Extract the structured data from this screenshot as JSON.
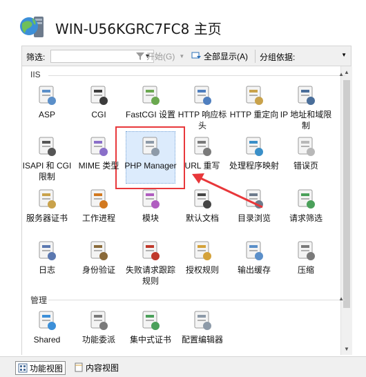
{
  "header": {
    "title": "WIN-U56KGRC7FC8 主页"
  },
  "toolbar": {
    "filter_label": "筛选:",
    "filter_value": "",
    "start_label": "开始(G)",
    "showall_label": "全部显示(A)",
    "groupby_label": "分组依据:"
  },
  "groups": [
    {
      "name": "IIS"
    },
    {
      "name": "管理"
    }
  ],
  "tiles": [
    {
      "label": "ASP",
      "icon": "asp-icon"
    },
    {
      "label": "CGI",
      "icon": "cgi-icon"
    },
    {
      "label": "FastCGI 设置",
      "icon": "fastcgi-icon"
    },
    {
      "label": "HTTP 响应标头",
      "icon": "http-headers-icon"
    },
    {
      "label": "HTTP 重定向",
      "icon": "http-redirect-icon"
    },
    {
      "label": "IP 地址和域限制",
      "icon": "ip-restrict-icon"
    },
    {
      "label": "ISAPI 和 CGI 限制",
      "icon": "isapi-cgi-icon"
    },
    {
      "label": "MIME 类型",
      "icon": "mime-icon"
    },
    {
      "label": "PHP Manager",
      "icon": "php-manager-icon"
    },
    {
      "label": "URL 重写",
      "icon": "url-rewrite-icon"
    },
    {
      "label": "处理程序映射",
      "icon": "handler-icon"
    },
    {
      "label": "错误页",
      "icon": "error-page-icon"
    },
    {
      "label": "服务器证书",
      "icon": "server-cert-icon"
    },
    {
      "label": "工作进程",
      "icon": "worker-process-icon"
    },
    {
      "label": "模块",
      "icon": "modules-icon"
    },
    {
      "label": "默认文档",
      "icon": "default-doc-icon"
    },
    {
      "label": "目录浏览",
      "icon": "dir-browse-icon"
    },
    {
      "label": "请求筛选",
      "icon": "request-filter-icon"
    },
    {
      "label": "日志",
      "icon": "logging-icon"
    },
    {
      "label": "身份验证",
      "icon": "auth-icon"
    },
    {
      "label": "失败请求跟踪规则",
      "icon": "failed-trace-icon"
    },
    {
      "label": "授权规则",
      "icon": "authz-icon"
    },
    {
      "label": "输出缓存",
      "icon": "output-cache-icon"
    },
    {
      "label": "压缩",
      "icon": "compression-icon"
    },
    {
      "label": "Shared",
      "icon": "shared-config-icon"
    },
    {
      "label": "功能委派",
      "icon": "delegation-icon"
    },
    {
      "label": "集中式证书",
      "icon": "central-cert-icon"
    },
    {
      "label": "配置编辑器",
      "icon": "config-editor-icon"
    }
  ],
  "bottom": {
    "features_view": "功能视图",
    "content_view": "内容视图"
  },
  "colors": {
    "highlight": "#e8373a",
    "selection": "#dcebfc"
  }
}
